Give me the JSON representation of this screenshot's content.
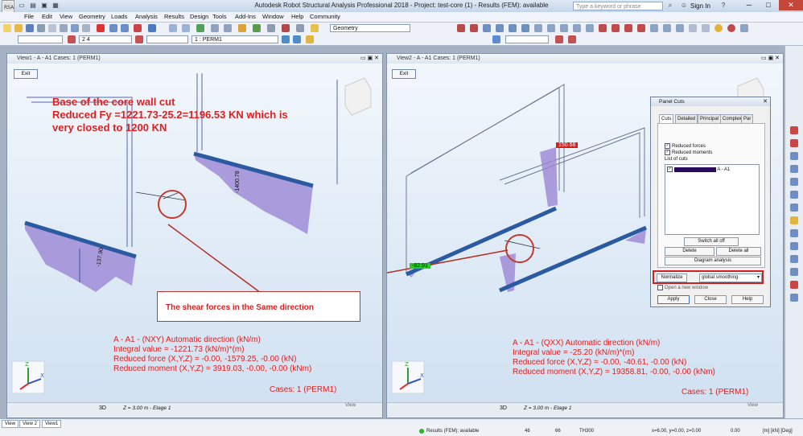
{
  "app": {
    "title": "Autodesk Robot Structural Analysis Professional 2018 - Project: test-core (1) - Results (FEM): available",
    "search_placeholder": "Type a keyword or phrase",
    "sign_in": "Sign In"
  },
  "menu": [
    "File",
    "Edit",
    "View",
    "Geometry",
    "Loads",
    "Analysis",
    "Results",
    "Design",
    "Tools",
    "Add-Ins",
    "Window",
    "Help",
    "Community"
  ],
  "toolbar": {
    "geometry_combo": "Geometry",
    "node_value": "2 4",
    "case_value": "1 : PERM1"
  },
  "view1": {
    "title": "View1 - A - A1 Cases: 1 (PERM1)",
    "exit": "Exit",
    "note": [
      "Base of the core wall cut",
      "Reduced Fy =1221.73-25.2=1196.53 KN which is",
      "very closed to 1200 KN"
    ],
    "label_a": "-1400.78",
    "label_b": "-137.90",
    "results": [
      "A - A1 - (NXY) Automatic direction (kN/m)",
      "Integral value = -1221.73 (kN/m)*(m)",
      "Reduced force (X,Y,Z) = -0.00, -1579.25, -0.00 (kN)",
      "Reduced moment (X,Y,Z) = 3919.03, -0.00, -0.00 (kNm)"
    ],
    "cases": "Cases: 1 (PERM1)",
    "mode": "3D",
    "storey": "Z = 3.00 m - Etage 1",
    "view_label": "View"
  },
  "view2": {
    "title": "View2 - A - A1 Cases: 1 (PERM1)",
    "exit": "Exit",
    "value_top": "150.68",
    "value_bottom": "-82.91",
    "results": [
      "A - A1 - (QXX) Automatic direction (kN/m)",
      "Integral value = -25.20 (kN/m)*(m)",
      "Reduced force (X,Y,Z) = -0.00, -40.61, -0.00 (kN)",
      "Reduced moment (X,Y,Z) = 19358.81, -0.00, -0.00 (kNm)"
    ],
    "cases": "Cases: 1 (PERM1)",
    "mode": "3D",
    "storey": "Z = 3.00 m - Etage 1",
    "view_label": "View"
  },
  "annotation": "The shear forces in the Same direction",
  "panel": {
    "title": "Panel Cuts",
    "tabs": [
      "Cuts",
      "Detailed",
      "Principal",
      "Complex",
      "Par"
    ],
    "reduced_forces": "Reduced forces",
    "reduced_moments": "Reduced moments",
    "list_label": "List of cuts",
    "cut_item": "A - A1",
    "switch_all_off": "Switch all off",
    "delete": "Delete",
    "delete_all": "Delete all",
    "diagram_analysis": "Diagram analysis",
    "normalize": "Normalize",
    "smoothing": "global smoothing",
    "open_window": "Open a new window",
    "apply": "Apply",
    "close": "Close",
    "help": "Help"
  },
  "bottom": {
    "tabs": [
      "View",
      "View 2",
      "View1"
    ],
    "status": "Results (FEM): available",
    "n1": "46",
    "n2": "66",
    "section": "TH300",
    "coords": "x=6.00, y=0.00, z=0.00",
    "z_value": "0.00",
    "units": "[m] [kN] [Deg]"
  },
  "colors": {
    "red": "#e02020",
    "accent": "#2c5aa0",
    "diagram": "#9b86d6"
  }
}
